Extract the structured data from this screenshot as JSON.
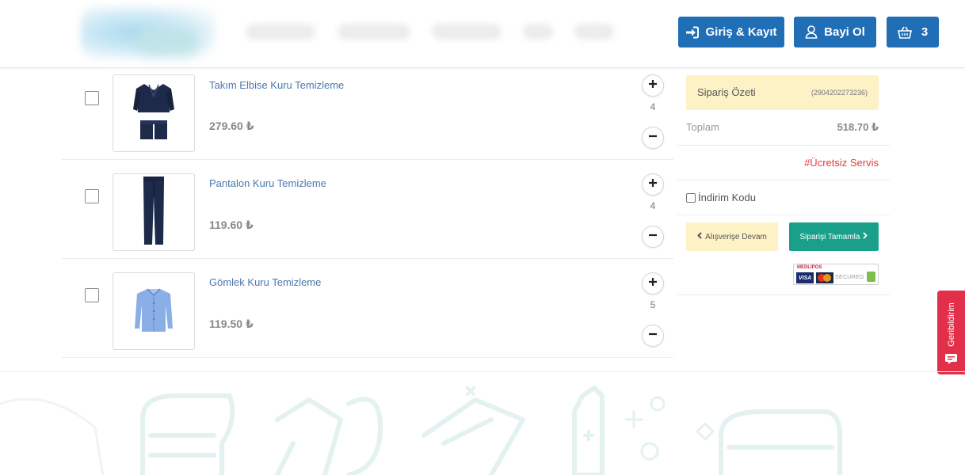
{
  "header": {
    "login_label": "Giriş & Kayıt",
    "dealer_label": "Bayi Ol",
    "cart_count": "3",
    "accent_color": "#1f6eb6"
  },
  "cart": {
    "items": [
      {
        "name": "Takım Elbise Kuru Temizleme",
        "price": "279.60 ₺",
        "quantity": "4",
        "icon": "suit-icon"
      },
      {
        "name": "Pantalon Kuru Temizleme",
        "price": "119.60 ₺",
        "quantity": "4",
        "icon": "trousers-icon"
      },
      {
        "name": "Gömlek Kuru Temizleme",
        "price": "119.50 ₺",
        "quantity": "5",
        "icon": "shirt-icon"
      }
    ]
  },
  "summary": {
    "title": "Sipariş Özeti",
    "order_code": "(2904202273236)",
    "total_label": "Toplam",
    "total_value": "518.70 ₺",
    "free_service": "#Ücretsiz Servis",
    "discount_label": "İndirim Kodu",
    "continue_label": "Alışverişe Devam",
    "complete_label": "Siparişi Tamamla",
    "secure_brand": "MEDLIPOS",
    "secure_visa": "VISA",
    "secure_text": "SECURED",
    "complete_color": "#1aa08a",
    "highlight_color": "#fdf1c6",
    "free_service_color": "#e33d3d"
  },
  "feedback": {
    "label": "Geribildirim",
    "color": "#e2304a"
  }
}
